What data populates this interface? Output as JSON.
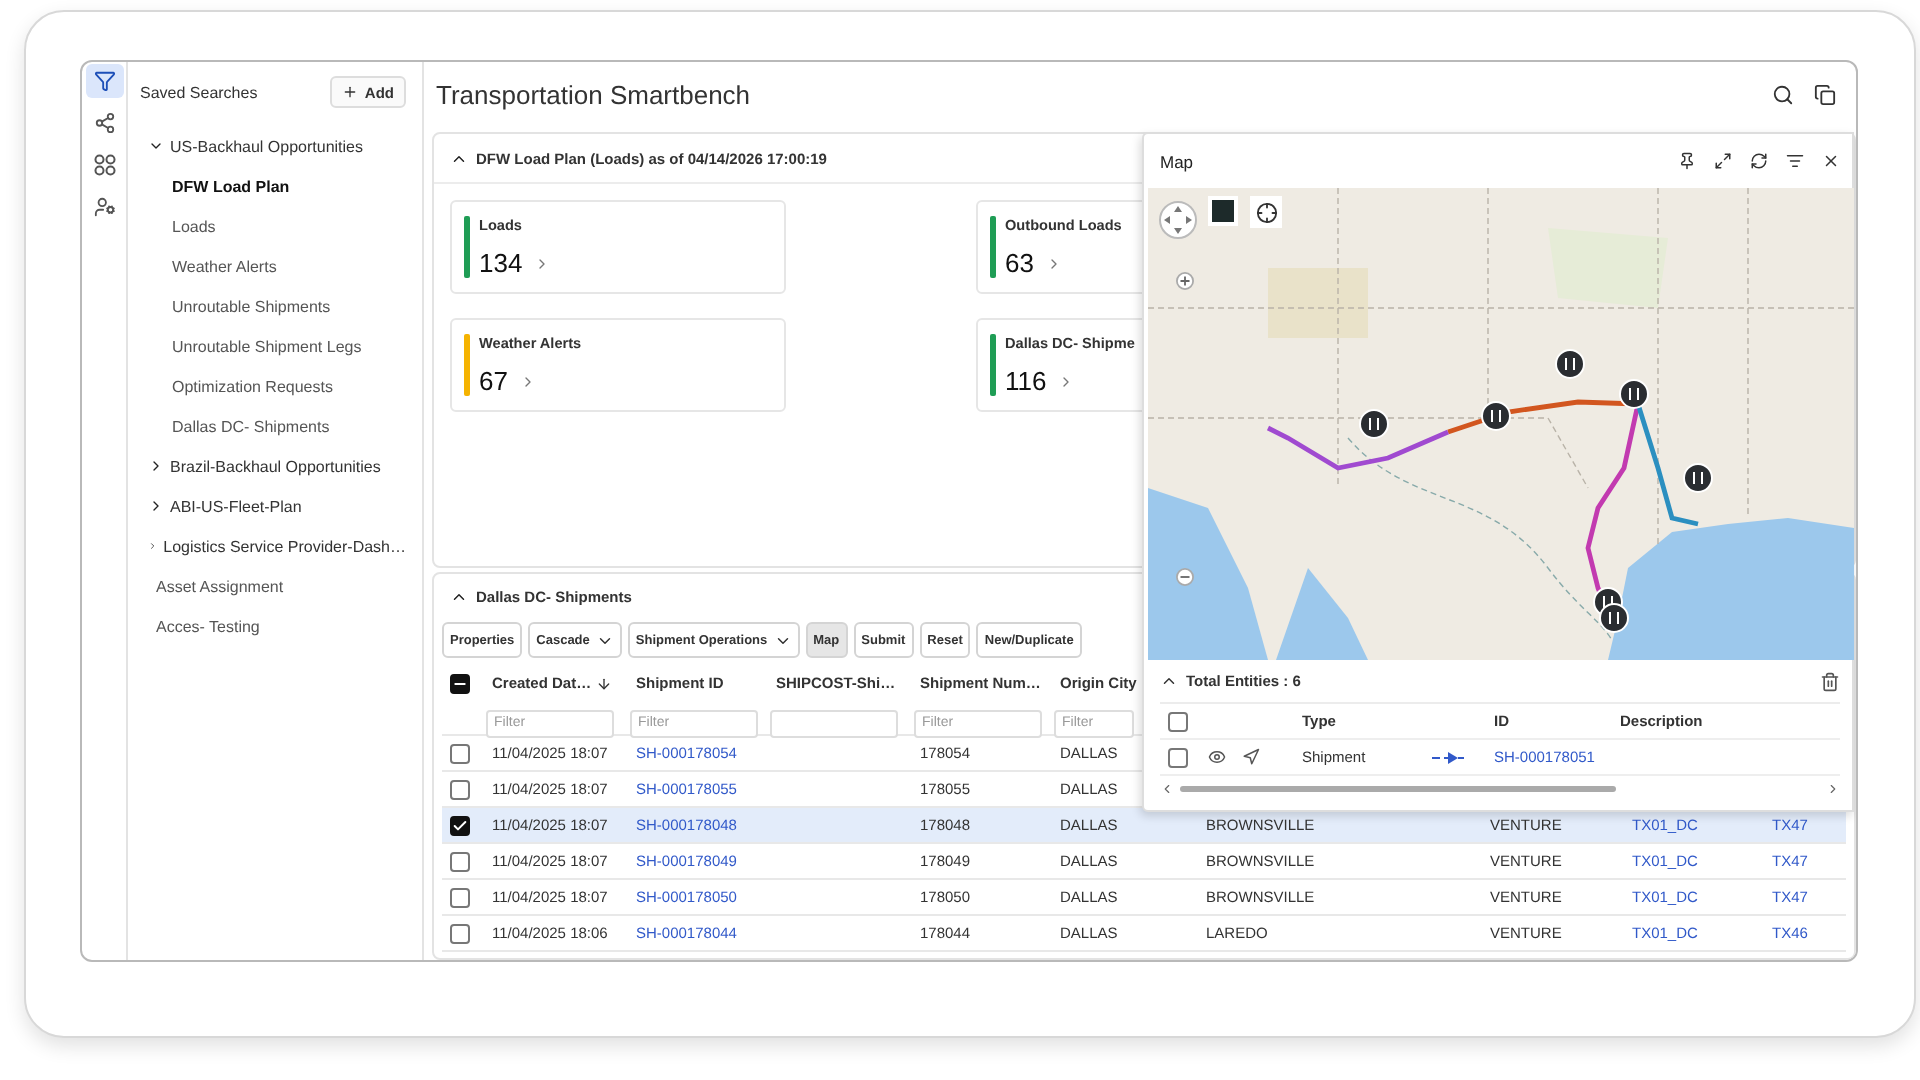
{
  "rail": [
    {
      "kind": "filter",
      "selected": true
    },
    {
      "kind": "share",
      "selected": false
    },
    {
      "kind": "apps",
      "selected": false
    },
    {
      "kind": "user-settings",
      "selected": false
    }
  ],
  "sidebar": {
    "title": "Saved Searches",
    "add_button": "Add",
    "items": [
      {
        "label": "US-Backhaul Opportunities",
        "expanded": true,
        "selected": false,
        "children": [
          {
            "label": "DFW Load Plan",
            "selected": true
          },
          {
            "label": "Loads",
            "selected": false
          },
          {
            "label": "Weather Alerts",
            "selected": false
          },
          {
            "label": "Unroutable Shipments",
            "selected": false
          },
          {
            "label": "Unroutable Shipment Legs",
            "selected": false
          },
          {
            "label": "Optimization Requests",
            "selected": false
          },
          {
            "label": "Dallas DC- Shipments",
            "selected": false
          }
        ]
      },
      {
        "label": "Brazil-Backhaul Opportunities",
        "expanded": false,
        "selected": false
      },
      {
        "label": "ABI-US-Fleet-Plan",
        "expanded": false,
        "selected": false
      },
      {
        "label": "Logistics Service Provider-Dash…",
        "expanded": false,
        "selected": false
      },
      {
        "label": "Asset Assignment",
        "selected": false
      },
      {
        "label": "Acces- Testing",
        "selected": false
      }
    ]
  },
  "title": "Transportation Smartbench",
  "summary": {
    "title": "DFW Load Plan (Loads) as of 04/14/2026 17:00:19",
    "expanded": true,
    "cards": [
      {
        "label": "Loads",
        "value": "134",
        "color": "#1f9d55"
      },
      {
        "label": "Outbound Loads",
        "value": "63",
        "color": "#1f9d55"
      },
      {
        "label": "Weather Alerts",
        "value": "67",
        "color": "#f5b301"
      },
      {
        "label": "Dallas DC- Shipme",
        "value": "116",
        "color": "#1f9d55"
      }
    ]
  },
  "shipments": {
    "title": "Dallas DC- Shipments",
    "expanded": true,
    "toolbar": [
      {
        "label": "Properties",
        "dropdown": false,
        "active": false
      },
      {
        "label": "Cascade",
        "dropdown": true,
        "active": false
      },
      {
        "label": "Shipment Operations",
        "dropdown": true,
        "active": false
      },
      {
        "label": "Map",
        "dropdown": false,
        "active": true
      },
      {
        "label": "Submit",
        "dropdown": false,
        "active": false
      },
      {
        "label": "Reset",
        "dropdown": false,
        "active": false
      },
      {
        "label": "New/Duplicate",
        "dropdown": false,
        "active": false
      }
    ],
    "select_all_partial": true,
    "columns": {
      "created": {
        "label": "Created Dat…",
        "sorted": true,
        "placeholder": "Filter"
      },
      "shipment_id": {
        "label": "Shipment ID",
        "sorted": false,
        "placeholder": "Filter"
      },
      "shipcost": {
        "label": "SHIPCOST-Shi…",
        "sorted": false
      },
      "shipment_number": {
        "label": "Shipment Num…",
        "sorted": false,
        "placeholder": "Filter"
      },
      "origin_city": {
        "label": "Origin City",
        "sorted": false,
        "placeholder": "Filter"
      }
    },
    "rows": [
      {
        "selected": false,
        "created": "11/04/2025 18:07",
        "shipment_id": "SH-000178054",
        "shipment_number": "178054",
        "origin_city": "DALLAS"
      },
      {
        "selected": false,
        "created": "11/04/2025 18:07",
        "shipment_id": "SH-000178055",
        "shipment_number": "178055",
        "origin_city": "DALLAS"
      },
      {
        "selected": true,
        "created": "11/04/2025 18:07",
        "shipment_id": "SH-000178048",
        "shipment_number": "178048",
        "origin_city": "DALLAS",
        "column_6": "BROWNSVILLE",
        "column_7": "VENTURE",
        "column_8": "TX01_DC",
        "column_9": "TX47"
      },
      {
        "selected": false,
        "created": "11/04/2025 18:07",
        "shipment_id": "SH-000178049",
        "shipment_number": "178049",
        "origin_city": "DALLAS",
        "column_6": "BROWNSVILLE",
        "column_7": "VENTURE",
        "column_8": "TX01_DC",
        "column_9": "TX47"
      },
      {
        "selected": false,
        "created": "11/04/2025 18:07",
        "shipment_id": "SH-000178050",
        "shipment_number": "178050",
        "origin_city": "DALLAS",
        "column_6": "BROWNSVILLE",
        "column_7": "VENTURE",
        "column_8": "TX01_DC",
        "column_9": "TX47"
      },
      {
        "selected": false,
        "created": "11/04/2025 18:06",
        "shipment_id": "SH-000178044",
        "shipment_number": "178044",
        "origin_city": "DALLAS",
        "column_6": "LAREDO",
        "column_7": "VENTURE",
        "column_8": "TX01_DC",
        "column_9": "TX46"
      }
    ]
  },
  "map": {
    "title": "Map",
    "entities": {
      "title": "Total Entities : 6",
      "expanded": true,
      "select_all_checked": false,
      "columns": [
        "Type",
        "ID",
        "Description"
      ],
      "rows": [
        {
          "checked": false,
          "type": "Shipment",
          "id": "SH-000178051"
        }
      ]
    }
  }
}
